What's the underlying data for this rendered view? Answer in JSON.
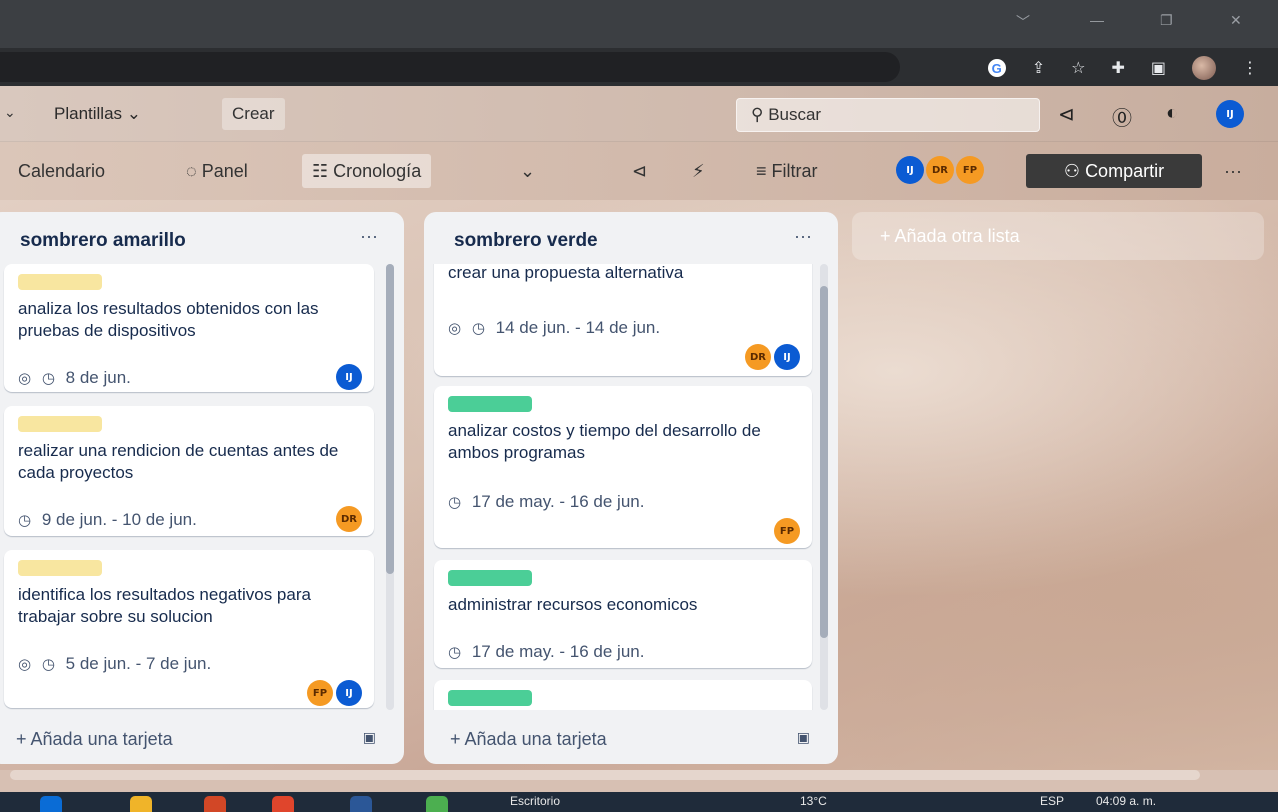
{
  "browser": {
    "window_controls": [
      "﹀",
      "—",
      "❐",
      "✕"
    ],
    "icons": [
      "google-icon",
      "share-icon",
      "star-icon",
      "extensions-icon",
      "sidepanel-icon",
      "profile-avatar",
      "menu-icon"
    ]
  },
  "header": {
    "templates_label": "Plantillas",
    "create_label": "Crear",
    "search_placeholder": "Buscar",
    "user_initials": "IJ"
  },
  "boardbar": {
    "calendar_label": "Calendario",
    "panel_label": "Panel",
    "timeline_label": "Cronología",
    "filter_label": "Filtrar",
    "share_label": "Compartir",
    "members": [
      "IJ",
      "DR",
      "FP"
    ],
    "more": "···"
  },
  "lists": [
    {
      "title": "sombrero amarillo",
      "menu": "···",
      "add_card": "Añada una tarjeta",
      "cards": [
        {
          "label_color": "#f8e6a0",
          "title": "analiza los resultados obtenidos con las pruebas de dispositivos",
          "date": "8 de jun.",
          "watch": true,
          "members": [
            "IJ"
          ]
        },
        {
          "label_color": "#f8e6a0",
          "title": "realizar una rendicion de cuentas antes de cada proyectos",
          "date": "9 de jun. - 10 de jun.",
          "watch": false,
          "members": [
            "DR"
          ]
        },
        {
          "label_color": "#f8e6a0",
          "title": "identifica los resultados negativos para trabajar sobre su solucion",
          "date": "5 de jun. - 7 de jun.",
          "watch": true,
          "members": [
            "FP",
            "IJ"
          ]
        }
      ]
    },
    {
      "title": "sombrero verde",
      "menu": "···",
      "add_card": "Añada una tarjeta",
      "cards": [
        {
          "title": "crear una propuesta alternativa",
          "date": "14 de jun. - 14 de jun.",
          "watch": true,
          "members": [
            "DR",
            "IJ"
          ]
        },
        {
          "label_color": "#4bce97",
          "title": "analizar costos y tiempo del desarrollo de ambos programas",
          "date": "17 de may. - 16 de jun.",
          "watch": false,
          "members": [
            "FP"
          ]
        },
        {
          "label_color": "#4bce97",
          "title": "administrar recursos economicos",
          "date": "17 de may. - 16 de jun.",
          "watch": false,
          "members": []
        },
        {
          "label_color": "#4bce97",
          "title": "",
          "date": "",
          "watch": false,
          "members": []
        }
      ]
    }
  ],
  "add_list_label": "Añada otra lista",
  "taskbar": {
    "desktop_label": "Escritorio",
    "temperature": "13°C",
    "language": "ESP",
    "time": "04:09 a. m."
  }
}
